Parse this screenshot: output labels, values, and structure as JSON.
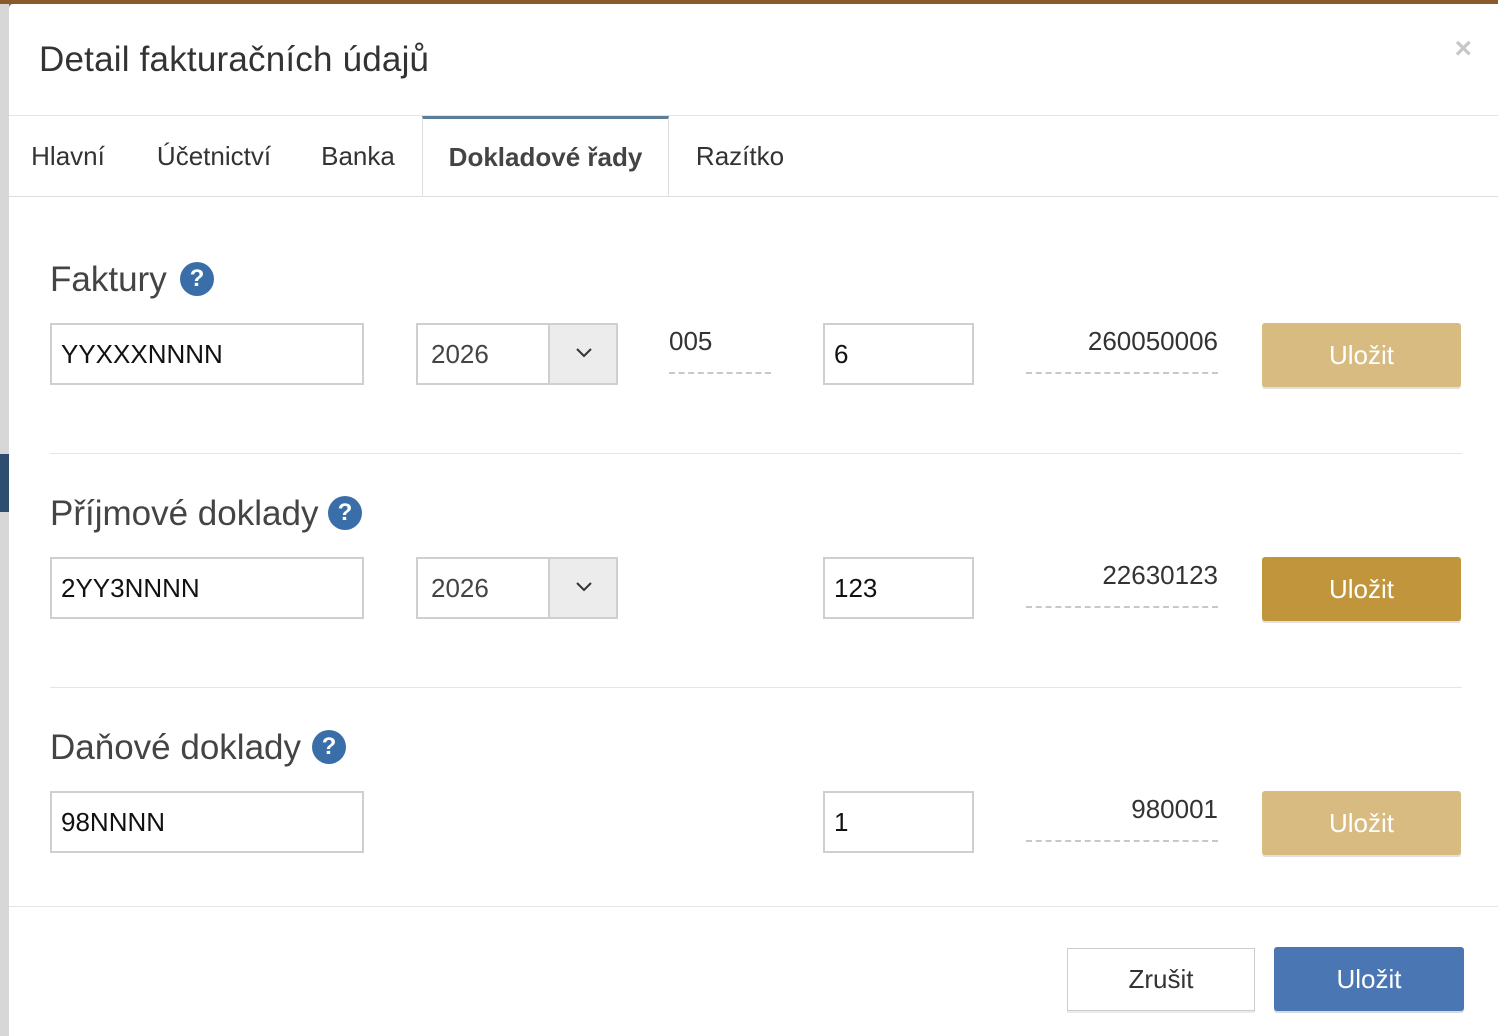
{
  "modal": {
    "title": "Detail fakturačních údajů",
    "close_label": "×"
  },
  "tabs": [
    {
      "label": "Hlavní",
      "active": false
    },
    {
      "label": "Účetnictví",
      "active": false
    },
    {
      "label": "Banka",
      "active": false
    },
    {
      "label": "Dokladové řady",
      "active": true
    },
    {
      "label": "Razítko",
      "active": false
    }
  ],
  "sections": [
    {
      "title": "Faktury",
      "help_icon": "?",
      "format": "YYXXXNNNN",
      "year": "2026",
      "code": "005",
      "next_number": "6",
      "preview": "260050006",
      "save_label": "Uložit",
      "save_state": "disabled"
    },
    {
      "title": "Příjmové doklady",
      "help_icon": "?",
      "format": "2YY3NNNN",
      "year": "2026",
      "next_number": "123",
      "preview": "22630123",
      "save_label": "Uložit",
      "save_state": "enabled"
    },
    {
      "title": "Daňové doklady",
      "help_icon": "?",
      "format": "98NNNN",
      "next_number": "1",
      "preview": "980001",
      "save_label": "Uložit",
      "save_state": "disabled"
    }
  ],
  "footer": {
    "cancel_label": "Zrušit",
    "save_label": "Uložit"
  },
  "colors": {
    "primary": "#4a77b4",
    "save_active": "#c0953b",
    "save_inactive": "#d8bb80",
    "help_icon": "#3a6ea8",
    "tab_active_border": "#5b7d98"
  }
}
